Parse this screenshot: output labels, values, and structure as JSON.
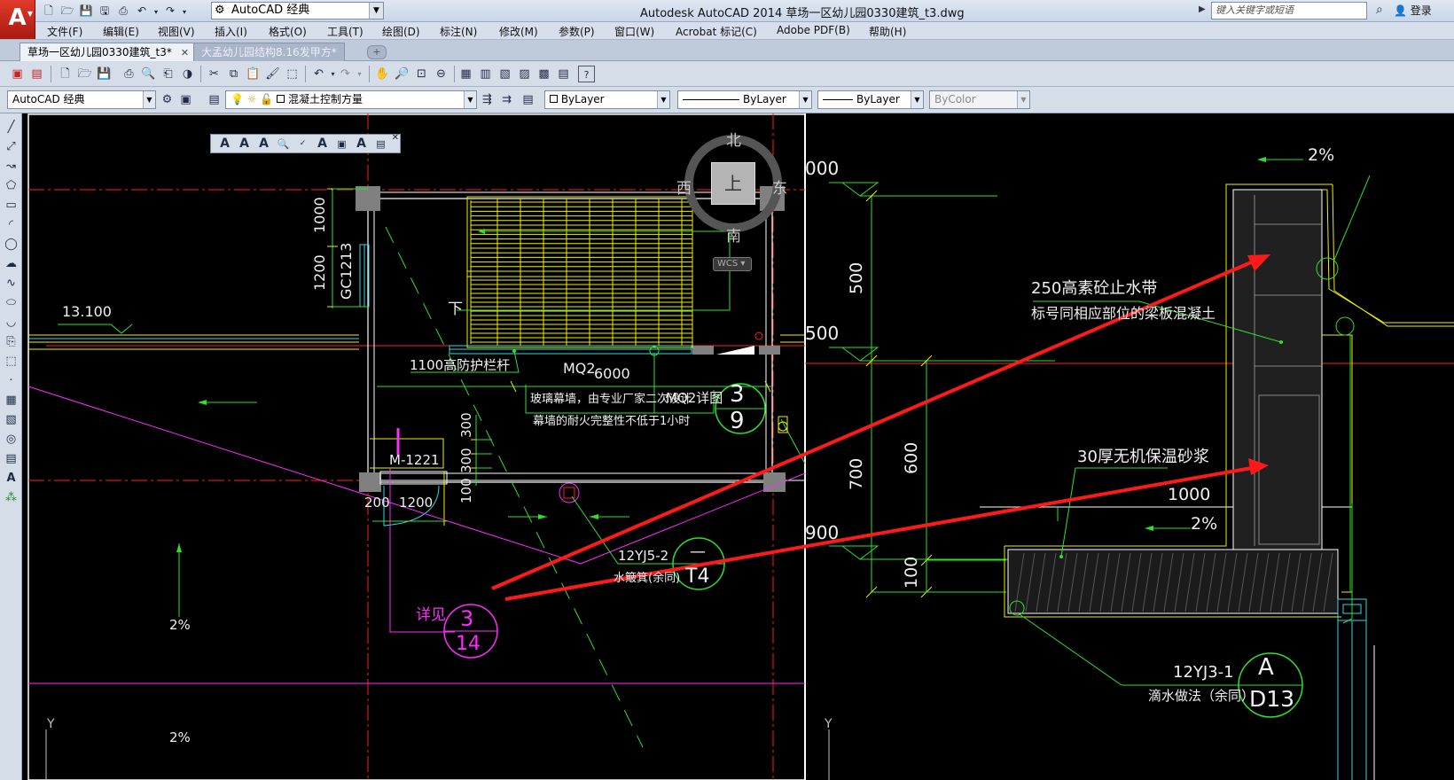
{
  "app": {
    "logo_letter": "A",
    "window_title": "Autodesk AutoCAD 2014    草场一区幼儿园0330建筑_t3.dwg",
    "workspace": "AutoCAD 经典",
    "search_placeholder": "键入关键字或短语",
    "login": "登录"
  },
  "menu": [
    "文件(F)",
    "编辑(E)",
    "视图(V)",
    "插入(I)",
    "格式(O)",
    "工具(T)",
    "绘图(D)",
    "标注(N)",
    "修改(M)",
    "参数(P)",
    "窗口(W)",
    "Acrobat 标记(C)",
    "Adobe PDF(B)",
    "帮助(H)"
  ],
  "tabs": [
    {
      "label": "草场一区幼儿园0330建筑_t3*",
      "active": true
    },
    {
      "label": "大孟幼儿园结构8.16发甲方*",
      "active": false
    }
  ],
  "toolbar2": {
    "workspace": "AutoCAD 经典",
    "layer": "混凝土控制方量",
    "color": "ByLayer",
    "linetype": "ByLayer",
    "lineweight": "ByLayer",
    "plotstyle": "ByColor"
  },
  "viewcube": {
    "north": "北",
    "south": "南",
    "west": "西",
    "east": "东",
    "top": "上",
    "wcs": "WCS"
  },
  "drawing": {
    "level_1310": "13.100",
    "dim_1000": "1000",
    "dim_1200": "1200",
    "window_gc": "GC1213",
    "stair_down": "下",
    "rail": "1100高防护栏杆",
    "mq2": "MQ2",
    "dim_6000": "6000",
    "curtain1": "玻璃幕墙，由专业厂家二次设计",
    "curtain2": "幕墙的耐火完整性不低于1小时",
    "mq2_detail": "MQ2详图",
    "detail_3_9_top": "3",
    "detail_3_9_bot": "9",
    "door": "M-1221",
    "dim_300a": "300",
    "dim_300b": "300",
    "dim_100": "100",
    "dim_200": "200",
    "dim_1200b": "1200",
    "ref_12yj5": "12YJ5-2",
    "ref_12yj5_note": "水簸箕(余同)",
    "t4_top": "—",
    "t4_bot": "T4",
    "see_detail": "详见",
    "detail_3_14_top": "3",
    "detail_3_14_bot": "14",
    "slope_left1": "2%",
    "slope_left2": "2%",
    "axis_y1": "Y",
    "axis_y2": "Y",
    "elev_000": "000",
    "elev_500": "500",
    "elev_900": "900",
    "r_dim_500": "500",
    "r_dim_600": "600",
    "r_dim_700": "700",
    "r_dim_100": "100",
    "r_slope_top": "2%",
    "r_slope_mid": "2%",
    "r_dim_1000": "1000",
    "waterstop1": "250高素砼止水带",
    "waterstop2": "标号同相应部位的梁板混凝土",
    "mortar": "30厚无机保温砂浆",
    "ref_12yj3": "12YJ3-1",
    "drip": "滴水做法（余同）",
    "detail_a_top": "A",
    "detail_a_bot": "D13"
  },
  "colors": {
    "wall": "#ffffff",
    "dim": "#2ee02e",
    "stair": "#f0f000",
    "magenta": "#ff2cff",
    "axis_red": "#ff2020",
    "arrow_red": "#ff1a1a",
    "cyan": "#35d9e6"
  }
}
